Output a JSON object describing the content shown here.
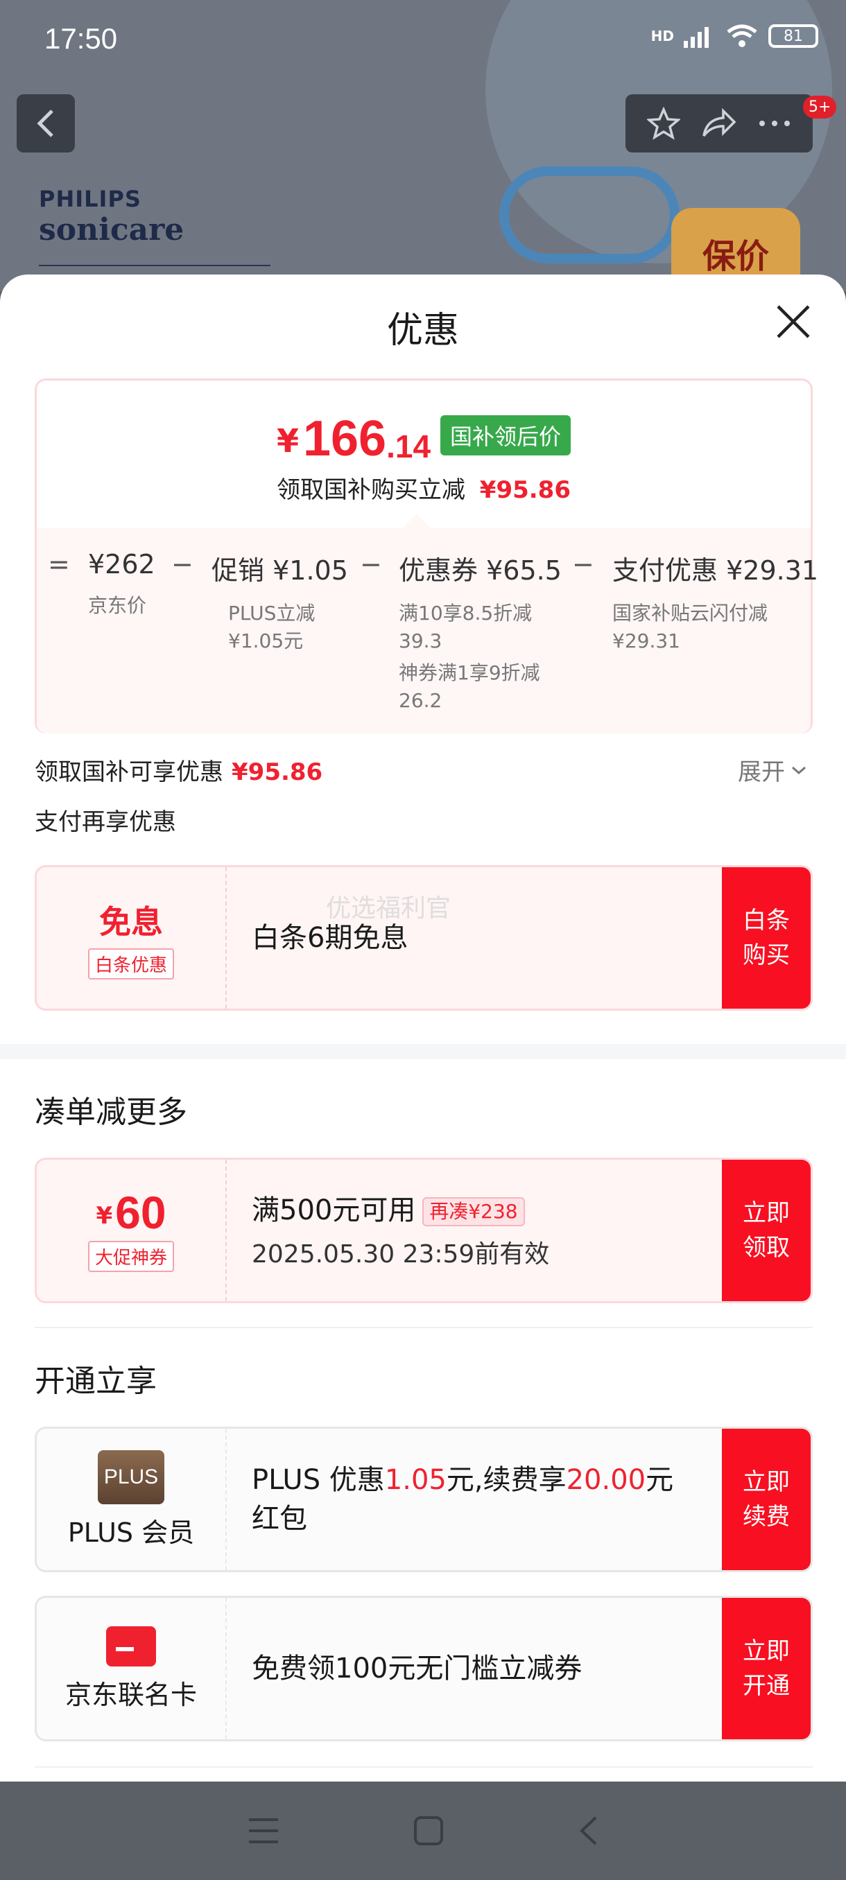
{
  "status_bar": {
    "time": "17:50",
    "battery": "81",
    "net": "HD"
  },
  "product_bg": {
    "brand_top": "PHILIPS",
    "brand_bottom": "sonicare",
    "guarantee": "保价",
    "more_badge": "5+"
  },
  "sheet": {
    "title": "优惠",
    "close_icon": "close-icon"
  },
  "price_summary": {
    "currency": "¥",
    "price_integer": "166",
    "price_decimal": ".14",
    "price_tag": "国补领后价",
    "subtitle_prefix": "领取国补购买立减",
    "subtitle_amount": "¥95.86",
    "breakdown": {
      "eq": "=",
      "minus": "−",
      "jd_price": "¥262",
      "jd_price_label": "京东价",
      "promo_label": "促销",
      "promo_value": "¥1.05",
      "promo_note_1": "PLUS立减",
      "promo_note_2": "¥1.05元",
      "coupon_label": "优惠券",
      "coupon_value": "¥65.5",
      "coupon_note_1": "满10享8.5折减",
      "coupon_note_2": "39.3",
      "coupon_note_3": "神券满1享9折减",
      "coupon_note_4": "26.2",
      "pay_label": "支付优惠",
      "pay_value": "¥29.31",
      "pay_note_1": "国家补贴云闪付减",
      "pay_note_2": "¥29.31"
    }
  },
  "subsidy_line": {
    "label": "领取国补可享优惠",
    "amount": "¥95.86",
    "expand": "展开"
  },
  "pay_more_label": "支付再享优惠",
  "baitiao": {
    "left_title": "免息",
    "left_tag": "白条优惠",
    "text": "白条6期免息",
    "cta": "白条\n购买",
    "watermark": "优选福利官"
  },
  "bundle": {
    "section_title": "凑单减更多",
    "currency": "¥",
    "amount": "60",
    "tag": "大促神券",
    "condition": "满500元可用",
    "rejoin": "再凑¥238",
    "validity": "2025.05.30 23:59前有效",
    "cta": "立即\n领取"
  },
  "open_section": {
    "section_title": "开通立享",
    "plus": {
      "logo": "PLUS",
      "label": "PLUS 会员",
      "text_a": "PLUS 优惠",
      "text_b": "1.05",
      "text_c": "元,续费享",
      "text_d": "20.00",
      "text_e": "元",
      "text_f": "红包",
      "cta": "立即\n续费"
    },
    "card": {
      "label": "京东联名卡",
      "text": "免费领100元无门槛立减券",
      "cta": "立即\n开通"
    }
  }
}
